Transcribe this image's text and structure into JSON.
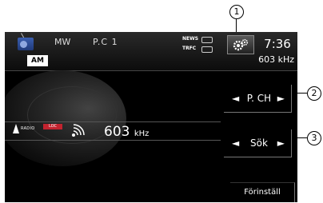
{
  "status": {
    "source_label": "AM",
    "band": "MW",
    "preset": "P.C 1",
    "news_label": "NEWS",
    "trfc_label": "TRFC",
    "clock": "7:36",
    "frequency_small": "603 kHz"
  },
  "main": {
    "radio_label": "RADIO",
    "loc_label": "LOC",
    "frequency_value": "603",
    "frequency_unit": "kHz"
  },
  "buttons": {
    "pch": "P. CH",
    "sok": "Sök",
    "forinstall": "Förinställ"
  },
  "callouts": [
    "1",
    "2",
    "3"
  ],
  "icons": {
    "settings": "gear-icon",
    "source": "radio-icon",
    "signal": "signal-icon"
  }
}
